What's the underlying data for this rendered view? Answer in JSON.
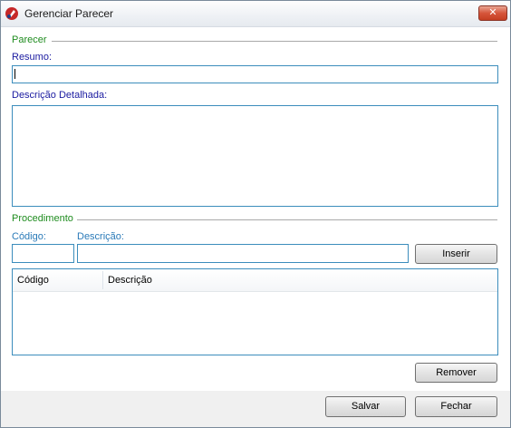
{
  "window": {
    "title": "Gerenciar Parecer",
    "close_glyph": "✕",
    "icon": "app-logo-icon"
  },
  "parecer": {
    "section_title": "Parecer",
    "resumo_label": "Resumo:",
    "resumo_value": "",
    "descricao_label": "Descrição Detalhada:",
    "descricao_value": ""
  },
  "procedimento": {
    "section_title": "Procedimento",
    "codigo_label": "Código:",
    "codigo_value": "",
    "descricao_label": "Descrição:",
    "descricao_value": "",
    "insert_label": "Inserir",
    "table": {
      "columns": [
        "Código",
        "Descrição"
      ],
      "rows": []
    },
    "remove_label": "Remover"
  },
  "footer": {
    "save_label": "Salvar",
    "close_label": "Fechar"
  },
  "colors": {
    "section": "#1f8c1f",
    "label_navy": "#1a1aa0",
    "label_blue": "#2a7ab8",
    "field_border": "#3c8dbc"
  }
}
